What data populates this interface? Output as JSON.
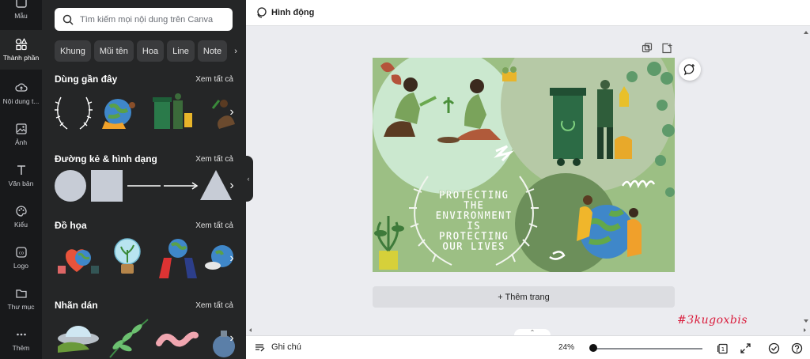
{
  "rail": [
    {
      "label": "Mẫu",
      "icon": "template-icon"
    },
    {
      "label": "Thành phần",
      "icon": "elements-icon",
      "active": true
    },
    {
      "label": "Nội dung t...",
      "icon": "upload-icon"
    },
    {
      "label": "Ảnh",
      "icon": "image-icon"
    },
    {
      "label": "Văn bản",
      "icon": "text-icon"
    },
    {
      "label": "Kiểu",
      "icon": "palette-icon"
    },
    {
      "label": "Logo",
      "icon": "logo-icon"
    },
    {
      "label": "Thư mục",
      "icon": "folder-icon"
    },
    {
      "label": "Thêm",
      "icon": "more-icon"
    }
  ],
  "search": {
    "placeholder": "Tìm kiếm mọi nội dung trên Canva"
  },
  "chips": [
    "Khung",
    "Mũi tên",
    "Hoa",
    "Line",
    "Note"
  ],
  "sections": {
    "recent": {
      "title": "Dùng gần đây",
      "see_all": "Xem tất cả"
    },
    "shapes": {
      "title": "Đường kẻ & hình dạng",
      "see_all": "Xem tất cả"
    },
    "graphics": {
      "title": "Đồ họa",
      "see_all": "Xem tất cả"
    },
    "stickers": {
      "title": "Nhãn dán",
      "see_all": "Xem tất cả"
    }
  },
  "topbar": {
    "animate_label": "Hình động"
  },
  "design": {
    "text_lines": [
      "PROTECTING",
      "THE",
      "ENVIRONMENT",
      "IS",
      "PROTECTING",
      "OUR LIVES"
    ]
  },
  "canvas": {
    "add_page_label": "+ Thêm trang"
  },
  "bottombar": {
    "notes_label": "Ghi chú",
    "zoom": "24%",
    "page_count": "1"
  },
  "overlay": {
    "hashtag": "#3kugoxbis"
  },
  "colors": {
    "panel_bg": "#252627",
    "rail_bg": "#18191b",
    "design_green": "#9cbf84",
    "accent_red": "#d91a3a"
  }
}
